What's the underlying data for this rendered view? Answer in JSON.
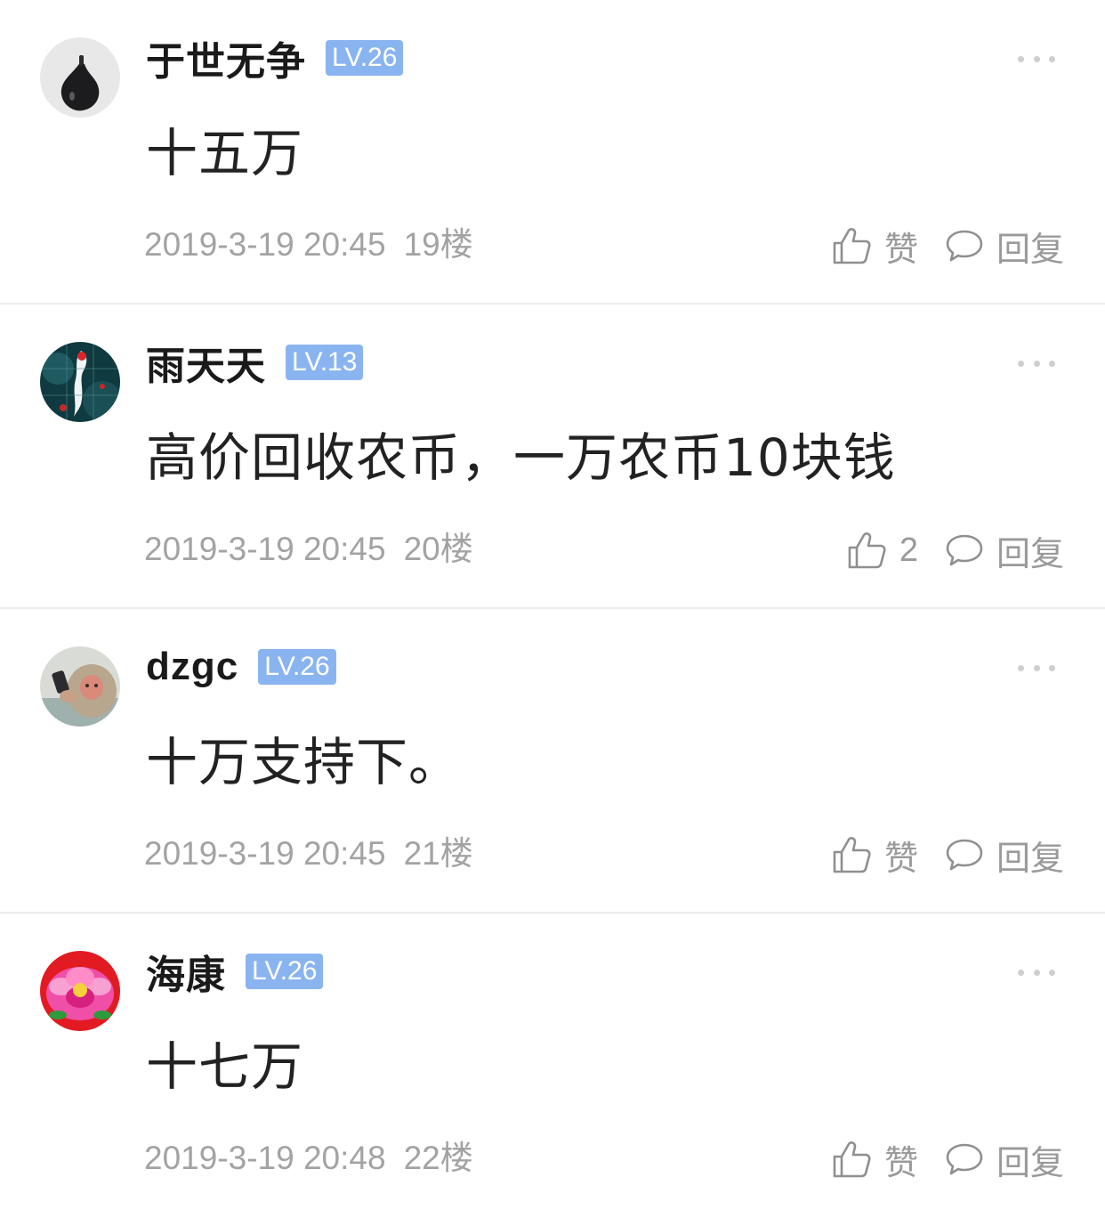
{
  "comments": [
    {
      "username": "于世无争",
      "level": "LV.26",
      "content": "十五万",
      "timestamp": "2019-3-19 20:45",
      "floor": "19楼",
      "like_label": "赞",
      "reply_label": "回复",
      "avatar": "fig-avatar"
    },
    {
      "username": "雨天天",
      "level": "LV.13",
      "content": "高价回收农币，一万农币10块钱",
      "timestamp": "2019-3-19 20:45",
      "floor": "20楼",
      "like_label": "2",
      "reply_label": "回复",
      "avatar": "koi-fish-avatar"
    },
    {
      "username": "dzgc",
      "level": "LV.26",
      "content": "十万支持下。",
      "timestamp": "2019-3-19 20:45",
      "floor": "21楼",
      "like_label": "赞",
      "reply_label": "回复",
      "avatar": "monkey-phone-avatar"
    },
    {
      "username": "海康",
      "level": "LV.26",
      "content": "十七万",
      "timestamp": "2019-3-19 20:48",
      "floor": "22楼",
      "like_label": "赞",
      "reply_label": "回复",
      "avatar": "peony-avatar"
    }
  ],
  "colors": {
    "level_badge": "#8ab4f0",
    "meta_text": "#a3a3a3",
    "divider": "#ececec"
  }
}
